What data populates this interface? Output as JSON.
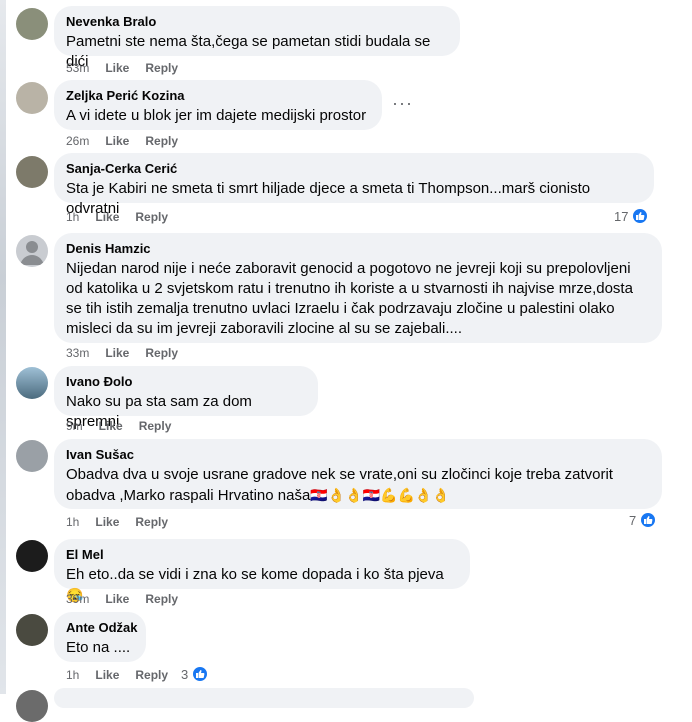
{
  "comments": [
    {
      "author": "Nevenka Bralo",
      "text": "Pametni ste nema šta,čega se pametan stidi budala se dići",
      "time": "53m",
      "like": "Like",
      "reply": "Reply",
      "avatar_color": "#8a8f7a"
    },
    {
      "author": "Zeljka Perić Kozina",
      "text": "A vi idete u blok jer im dajete medijski prostor",
      "time": "26m",
      "like": "Like",
      "reply": "Reply",
      "avatar_color": "#b9b3a6"
    },
    {
      "author": "Sanja-Cerka Cerić",
      "text": "Sta je Kabiri ne smeta ti smrt hiljade djece a smeta ti Thompson...marš cionisto odvratni",
      "time": "1h",
      "like": "Like",
      "reply": "Reply",
      "reactions": "17",
      "avatar_color": "#7d7a6a"
    },
    {
      "author": "Denis Hamzic",
      "lines": [
        "Nijedan narod nije i neće zaboravit genocid a pogotovo ne jevreji koji su prepolovljeni",
        "od katolika u 2 svjetskom ratu i trenutno ih koriste a u stvarnosti ih najvise mrze,dosta",
        "se tih istih zemalja trenutno uvlaci Izraelu i čak podrzavaju zločine u palestini olako",
        "misleci da su im jevreji zaboravili zlocine al su se zajebali...."
      ],
      "time": "33m",
      "like": "Like",
      "reply": "Reply",
      "avatar_color": "#c9ccd1"
    },
    {
      "author": "Ivano Đolo",
      "text": "Nako su pa sta sam za dom spremni",
      "time": "9m",
      "like": "Like",
      "reply": "Reply",
      "avatar_color": "#5f7f95"
    },
    {
      "author": "Ivan Sušac",
      "lines": [
        "Obadva dva u svoje usrane gradove nek se vrate,oni su zločinci koje treba zatvorit",
        "obadva ,Marko raspali Hrvatino naša"
      ],
      "emoji": "🇭🇷👌👌🇭🇷💪💪👌👌",
      "time": "1h",
      "like": "Like",
      "reply": "Reply",
      "reactions": "7",
      "avatar_color": "#9aa0a6"
    },
    {
      "author": "El Mel",
      "text": "Eh eto..da se vidi i zna ko se kome dopada i ko šta pjeva",
      "emoji": "😪",
      "time": "39m",
      "like": "Like",
      "reply": "Reply",
      "avatar_color": "#1c1c1c"
    },
    {
      "author": "Ante Odžak",
      "text": "Eto na ....",
      "time": "1h",
      "like": "Like",
      "reply": "Reply",
      "reactions": "3",
      "avatar_color": "#4a4a40"
    }
  ],
  "icons": {
    "more": "more-options-icon",
    "like_reaction": "thumbs-up-icon"
  },
  "colors": {
    "bubble": "#f0f2f5",
    "meta": "#65676b",
    "like_blue": "#1877f2"
  }
}
